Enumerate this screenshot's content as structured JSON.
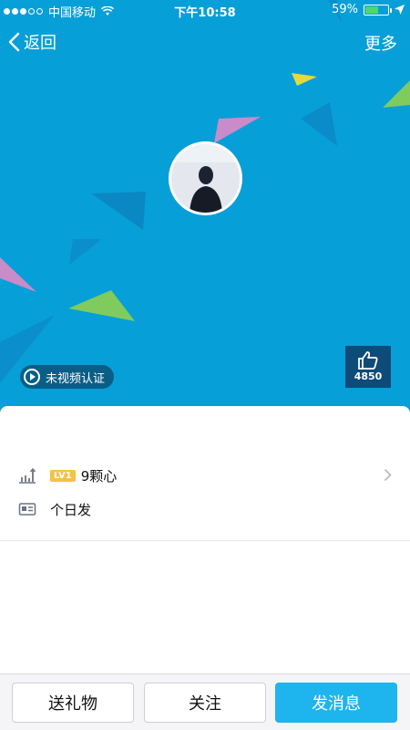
{
  "status_bar": {
    "carrier": "中国移动",
    "time": "下午10:58",
    "battery_percent": "59%",
    "battery_level": 0.59,
    "signal_bars_filled": 3,
    "signal_bars_total": 5
  },
  "nav": {
    "back_label": "返回",
    "more_label": "更多"
  },
  "profile": {
    "video_badge_label": "未视频认证",
    "like_count": "4850"
  },
  "info": {
    "level_badge": "LV1",
    "hearts_label": "9颗心",
    "signature": "个日发"
  },
  "actions": {
    "gift_label": "送礼物",
    "follow_label": "关注",
    "message_label": "发消息"
  },
  "colors": {
    "cover_background": "#079fd8",
    "primary_button": "#1eb5ef",
    "level_badge": "#f5c242",
    "like_box": "#0e4b78"
  },
  "icons": {
    "back": "chevron-left-icon",
    "like": "thumbs-up-icon",
    "play": "play-icon",
    "level": "bar-chart-up-icon",
    "card": "id-card-icon",
    "wifi": "wifi-icon",
    "location": "location-arrow-icon"
  }
}
